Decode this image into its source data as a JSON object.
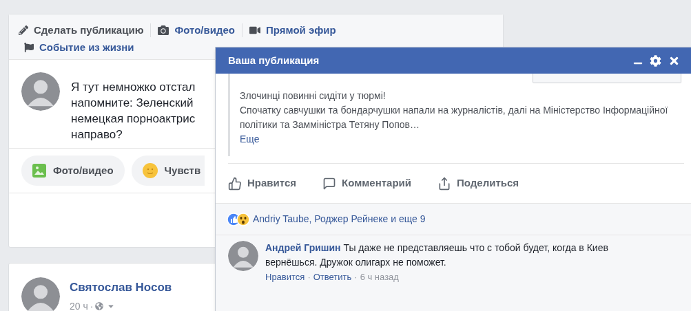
{
  "composer": {
    "tabs": [
      {
        "label": "Сделать публикацию",
        "kind": "compose"
      },
      {
        "label": "Фото/видео",
        "kind": "photo"
      },
      {
        "label": "Прямой эфир",
        "kind": "live"
      },
      {
        "label": "Событие из жизни",
        "kind": "event"
      }
    ],
    "text_lines": [
      "Я тут немножко отстал",
      "напомните: Зеленский",
      "немецкая порноактрис",
      "направо?"
    ],
    "actions": [
      {
        "label": "Фото/видео",
        "kind": "photo"
      },
      {
        "label": "Чувств",
        "kind": "feeling"
      }
    ]
  },
  "post": {
    "author": "Святослав Носов",
    "time": "20 ч",
    "separator": "·"
  },
  "chat": {
    "title": "Ваша публикация",
    "post_lines": [
      "Злочинці повинні сидіти у тюрмі!",
      "Спочатку савчушки та бондарчушки напали на журналістів, далі на Міністерство Інформаційної політики та Замміністра Тетяну Попов…"
    ],
    "more_link": "Еще",
    "actions": [
      {
        "label": "Нравится",
        "kind": "like"
      },
      {
        "label": "Комментарий",
        "kind": "comment"
      },
      {
        "label": "Поделиться",
        "kind": "share"
      }
    ],
    "reactions": "Andriy Taube, Роджер Рейнеке и еще 9",
    "comment": {
      "author": "Андрей Гришин",
      "text": "Ты даже не представляешь что с тобой будет, когда в Киев вернёшься. Дружок олигарх не поможет.",
      "links": [
        "Нравится",
        "Ответить"
      ],
      "separator": "·",
      "time": "6 ч назад"
    }
  }
}
